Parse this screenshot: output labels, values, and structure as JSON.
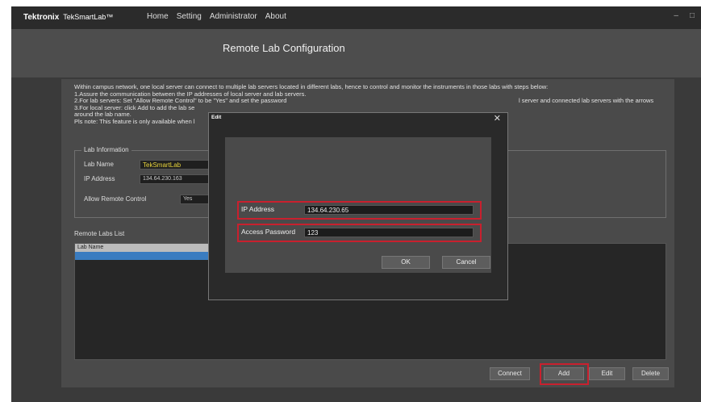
{
  "titlebar": {
    "brand": "Tektronix",
    "app_name": "TekSmartLab™",
    "menu": [
      "Home",
      "Setting",
      "Administrator",
      "About"
    ],
    "minimize": "–",
    "restore": "□"
  },
  "page": {
    "title": "Remote Lab Configuration"
  },
  "instructions": [
    "Within campus network, one local server can connect to multiple lab servers located in different labs, hence to control and monitor the instruments in those labs with steps below:",
    "1.Assure the communication between the IP addresses of local server and lab servers.",
    "2.For lab servers: Set \"Allow Remote Control\" to be \"Yes\" and set the password",
    "3.For local server: click Add to add the lab se",
    "around the lab name.",
    "Pls note: This feature is only available when l"
  ],
  "instructions_tail": "l server and connected lab servers with the arrows",
  "lab_info": {
    "legend": "Lab Information",
    "lab_name_label": "Lab Name",
    "lab_name_value": "TekSmartLab",
    "ip_label": "IP Address",
    "ip_value": "134.64.230.163",
    "allow_label": "Allow Remote Control",
    "allow_value": "Yes"
  },
  "remote_list": {
    "label": "Remote Labs List",
    "column": "Lab Name"
  },
  "actions": {
    "connect": "Connect",
    "add": "Add",
    "edit": "Edit",
    "delete": "Delete"
  },
  "dialog": {
    "title": "Edit",
    "close": "✕",
    "ip_label": "IP Address",
    "ip_value": "134.64.230.65",
    "password_label": "Access Password",
    "password_value": "123",
    "ok": "OK",
    "cancel": "Cancel"
  },
  "colors": {
    "highlight": "#c9202e",
    "selection": "#3a7cc0",
    "lab_name_text": "#e8d43c"
  }
}
